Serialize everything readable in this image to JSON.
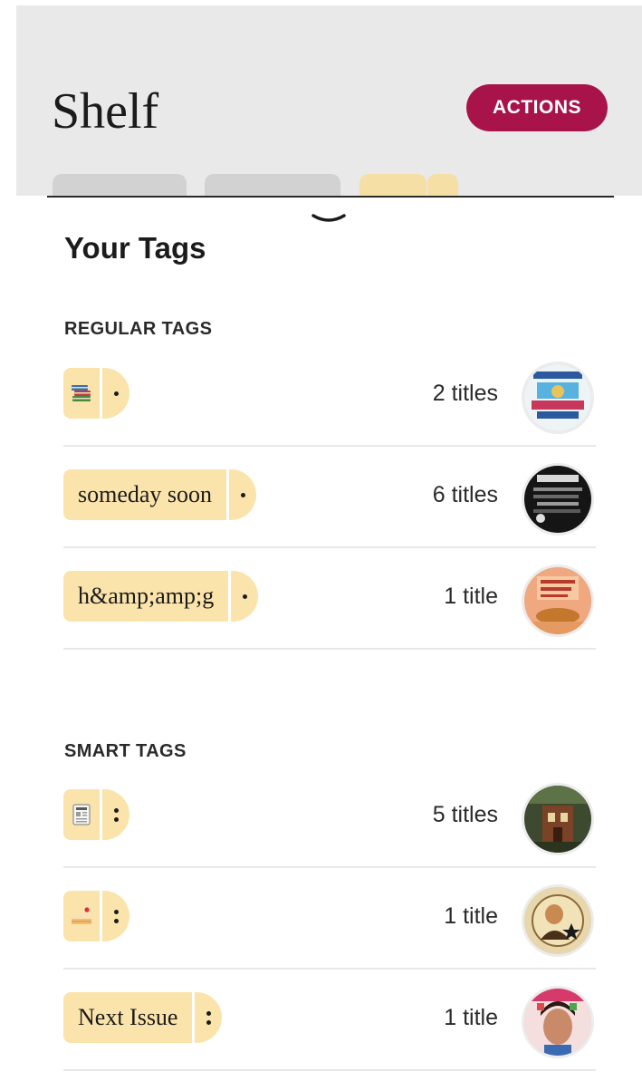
{
  "header": {
    "title": "Shelf",
    "actions_label": "ACTIONS",
    "accent_color": "#a8144a"
  },
  "sheet": {
    "title": "Your Tags",
    "regular_section": {
      "heading": "REGULAR TAGS",
      "tags": [
        {
          "label": "",
          "icon": "books-emoji-icon",
          "count": "2 titles",
          "cover": "cover-thumb-1"
        },
        {
          "label": "someday soon",
          "icon": "",
          "count": "6 titles",
          "cover": "cover-thumb-2"
        },
        {
          "label": "h&amp;amp;g",
          "icon": "",
          "count": "1 title",
          "cover": "cover-thumb-3"
        }
      ]
    },
    "smart_section": {
      "heading": "SMART TAGS",
      "tags": [
        {
          "label": "",
          "icon": "newspaper-emoji-icon",
          "count": "5 titles",
          "cover": "cover-thumb-4"
        },
        {
          "label": "",
          "icon": "cake-emoji-icon",
          "count": "1 title",
          "cover": "cover-thumb-5"
        },
        {
          "label": "Next Issue",
          "icon": "",
          "count": "1 title",
          "cover": "cover-thumb-6"
        }
      ]
    },
    "chip_color": "#fbe4ab"
  }
}
